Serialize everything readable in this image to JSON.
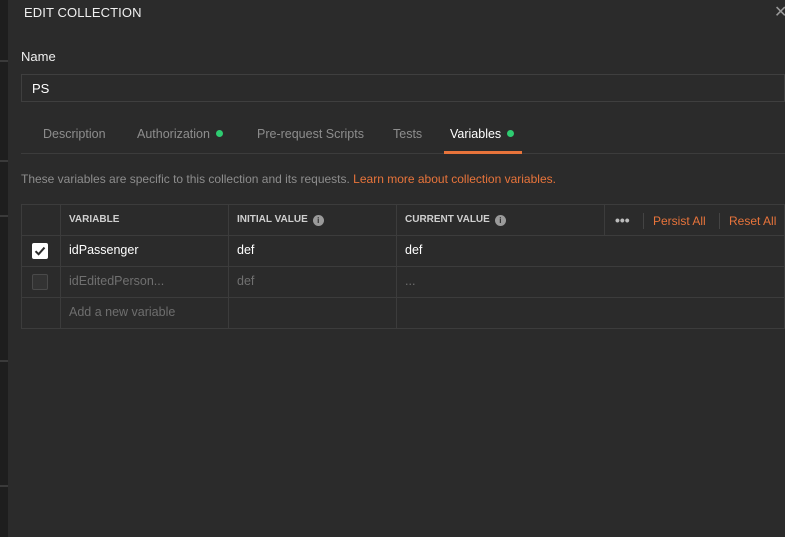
{
  "modal": {
    "title": "EDIT COLLECTION",
    "name_label": "Name",
    "name_value": "PS"
  },
  "tabs": [
    {
      "label": "Description",
      "active": false,
      "dot": false
    },
    {
      "label": "Authorization",
      "active": false,
      "dot": true
    },
    {
      "label": "Pre-request Scripts",
      "active": false,
      "dot": false
    },
    {
      "label": "Tests",
      "active": false,
      "dot": false
    },
    {
      "label": "Variables",
      "active": true,
      "dot": true
    }
  ],
  "info": {
    "text": "These variables are specific to this collection and its requests. ",
    "link": "Learn more about collection variables."
  },
  "table": {
    "headers": {
      "variable": "VARIABLE",
      "initial": "INITIAL VALUE",
      "current": "CURRENT VALUE",
      "persist_all": "Persist All",
      "reset_all": "Reset All"
    },
    "rows": [
      {
        "enabled": true,
        "variable": "idPassenger",
        "initial": "def",
        "current": "def"
      },
      {
        "enabled": false,
        "variable": "idEditedPerson...",
        "initial": "def",
        "current": "..."
      }
    ],
    "add_placeholder": "Add a new variable"
  },
  "colors": {
    "accent": "#e8743b",
    "dot": "#2ecc71",
    "background": "#2b2b2b"
  }
}
